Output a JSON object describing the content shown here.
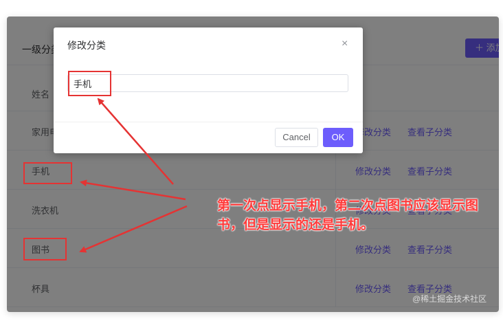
{
  "page": {
    "title": "一级分类",
    "add_button": "＋ 添加"
  },
  "table": {
    "header_name": "姓名",
    "rows": [
      {
        "name": "家用电器",
        "edit": "修改分类",
        "view": "查看子分类"
      },
      {
        "name": "手机",
        "edit": "修改分类",
        "view": "查看子分类"
      },
      {
        "name": "洗衣机",
        "edit": "修改分类",
        "view": "查看子分类"
      },
      {
        "name": "图书",
        "edit": "修改分类",
        "view": "查看子分类"
      },
      {
        "name": "杯具",
        "edit": "修改分类",
        "view": "查看子分类"
      }
    ]
  },
  "dialog": {
    "title": "修改分类",
    "close": "×",
    "input_value": "手机",
    "cancel": "Cancel",
    "ok": "OK"
  },
  "annotation": {
    "text": "第一次点显示手机，第二次点图书应该显示图书，但是显示的还是手机。"
  },
  "watermark": "@稀土掘金技术社区",
  "colors": {
    "accent": "#6d5dfc",
    "annotation_red": "#e53333"
  }
}
